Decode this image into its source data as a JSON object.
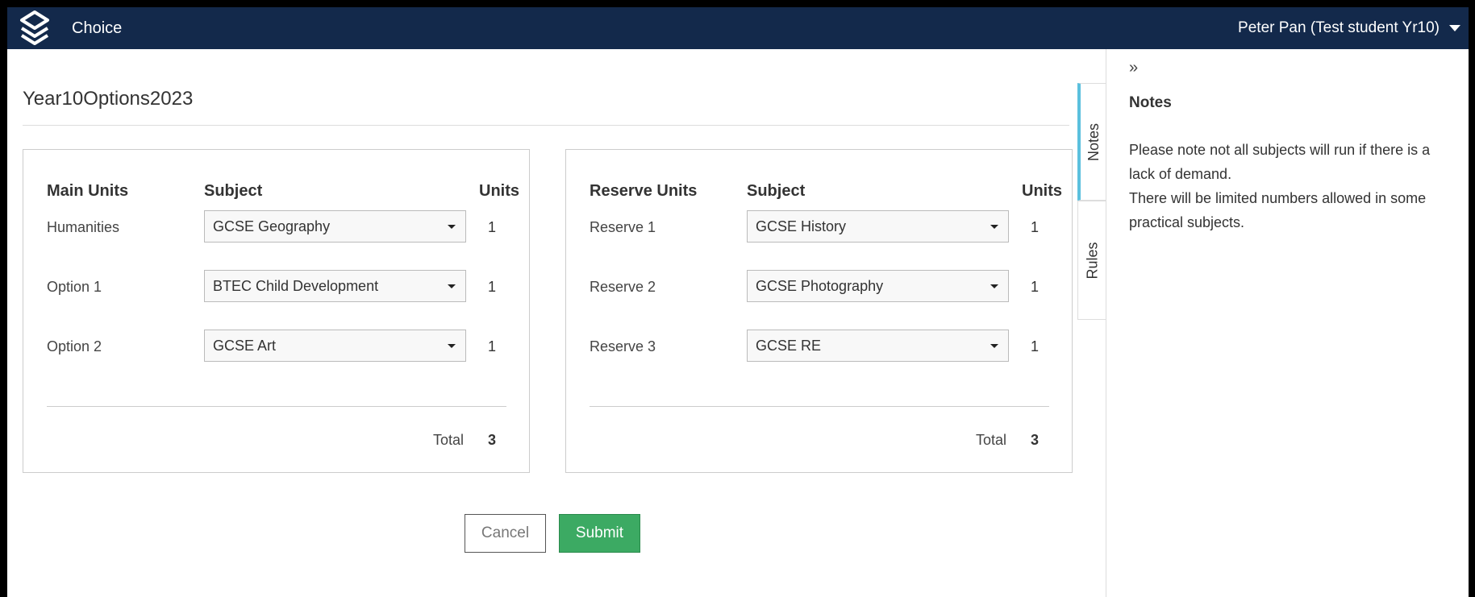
{
  "header": {
    "app_title": "Choice",
    "user_name": "Peter Pan (Test student Yr10)"
  },
  "page": {
    "title": "Year10Options2023"
  },
  "main_units": {
    "col_name": "Main Units",
    "col_subject": "Subject",
    "col_units": "Units",
    "rows": [
      {
        "label": "Humanities",
        "subject": "GCSE Geography",
        "units": "1"
      },
      {
        "label": "Option 1",
        "subject": "BTEC Child Development",
        "units": "1"
      },
      {
        "label": "Option 2",
        "subject": "GCSE Art",
        "units": "1"
      }
    ],
    "total_label": "Total",
    "total_value": "3"
  },
  "reserve_units": {
    "col_name": "Reserve Units",
    "col_subject": "Subject",
    "col_units": "Units",
    "rows": [
      {
        "label": "Reserve 1",
        "subject": "GCSE History",
        "units": "1"
      },
      {
        "label": "Reserve 2",
        "subject": "GCSE Photography",
        "units": "1"
      },
      {
        "label": "Reserve 3",
        "subject": "GCSE RE",
        "units": "1"
      }
    ],
    "total_label": "Total",
    "total_value": "3"
  },
  "actions": {
    "cancel_label": "Cancel",
    "submit_label": "Submit"
  },
  "side_tabs": {
    "notes_label": "Notes",
    "rules_label": "Rules"
  },
  "sidebar": {
    "collapse_glyph": "»",
    "heading": "Notes",
    "line1": "Please note not all subjects will run if there is a lack of demand.",
    "line2": "There will be limited numbers allowed in some practical subjects."
  },
  "colors": {
    "topbar": "#13294b",
    "submit": "#3caa63",
    "active_tab_accent": "#5bc0de"
  }
}
